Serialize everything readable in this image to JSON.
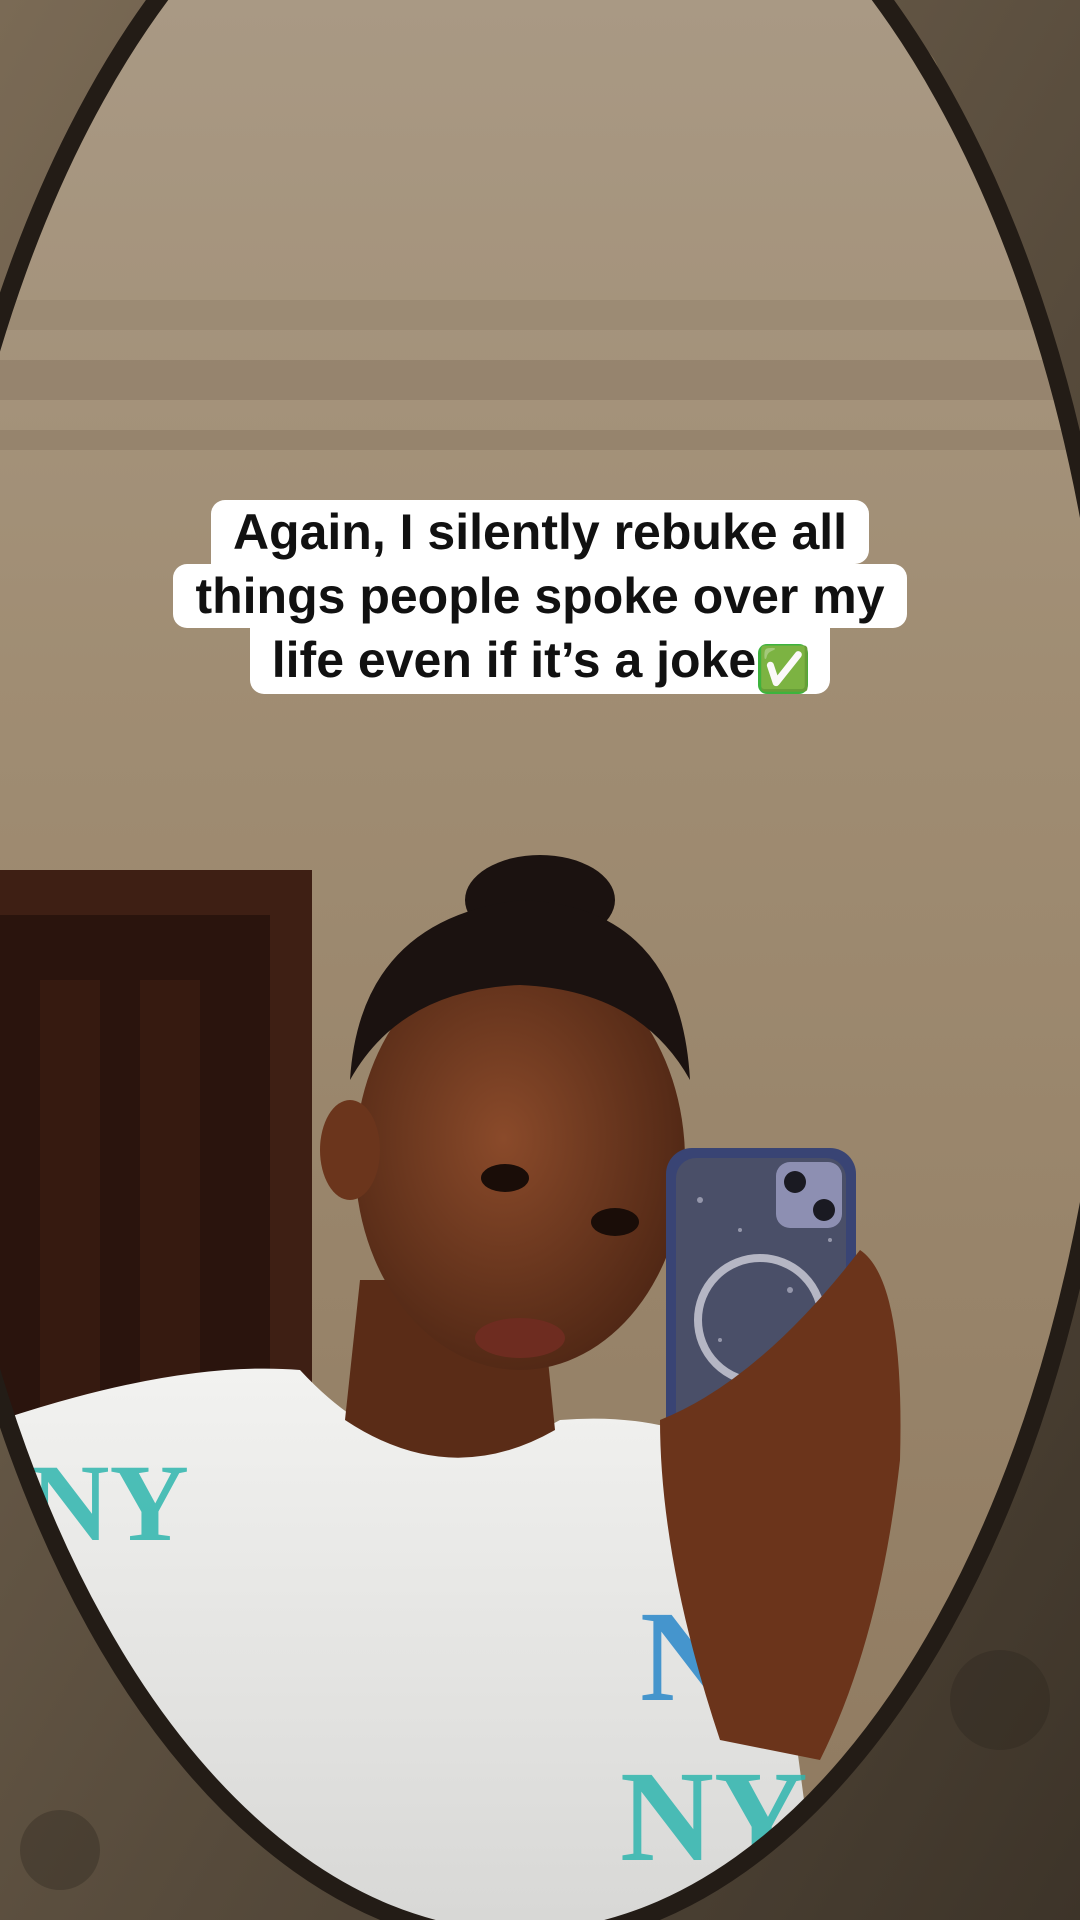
{
  "caption": {
    "lines": [
      "Again,  I silently rebuke all",
      "things people spoke over my",
      "life even if it’s a joke"
    ],
    "emoji": "✅",
    "emoji_name": "check-mark-button-icon"
  },
  "colors": {
    "caption_bg": "#ffffff",
    "caption_text": "#111111",
    "check_bg": "#3db33d"
  }
}
